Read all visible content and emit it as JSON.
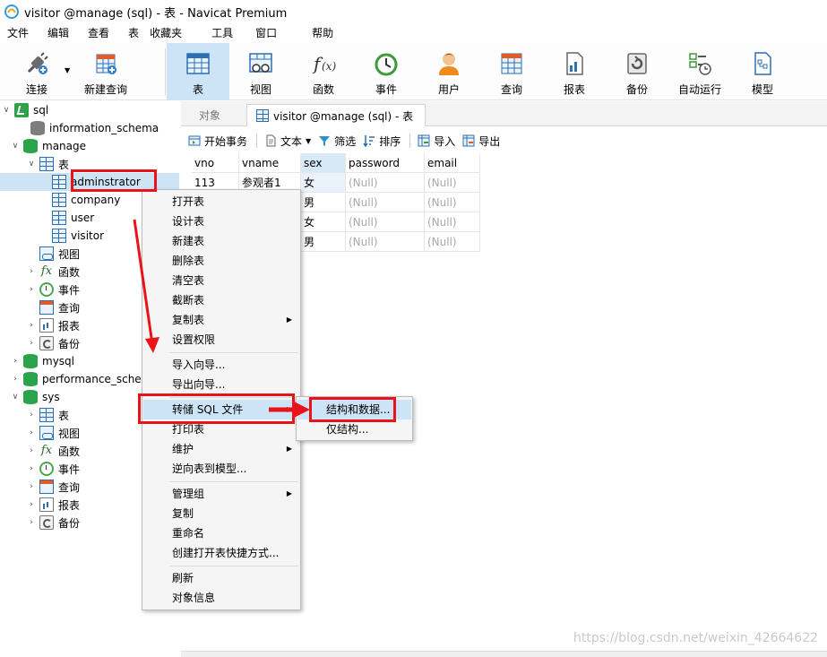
{
  "window": {
    "title": "visitor @manage (sql) - 表 - Navicat Premium"
  },
  "menu": [
    "文件",
    "编辑",
    "查看",
    "表",
    "收藏夹",
    "工具",
    "窗口",
    "帮助"
  ],
  "toolbar": {
    "connect": "连接",
    "new_query": "新建查询",
    "table": "表",
    "view": "视图",
    "function": "函数",
    "event": "事件",
    "user": "用户",
    "query": "查询",
    "report": "报表",
    "backup": "备份",
    "autorun": "自动运行",
    "model": "模型"
  },
  "tree": {
    "sql": "sql",
    "information_schema": "information_schema",
    "manage": "manage",
    "tables": "表",
    "adminstrator": "adminstrator",
    "company": "company",
    "user": "user",
    "visitor": "visitor",
    "views": "视图",
    "functions": "函数",
    "events": "事件",
    "queries": "查询",
    "reports": "报表",
    "backups": "备份",
    "mysql": "mysql",
    "performance_schema": "performance_sche",
    "sys": "sys",
    "sys_tables": "表",
    "sys_views": "视图",
    "sys_functions": "函数",
    "sys_events": "事件",
    "sys_queries": "查询",
    "sys_reports": "报表",
    "sys_backups": "备份"
  },
  "tabs": {
    "objects": "对象",
    "current": "visitor @manage (sql) - 表"
  },
  "table_toolbar": {
    "begin_tx": "开始事务",
    "text": "文本",
    "filter": "筛选",
    "sort": "排序",
    "import": "导入",
    "export": "导出"
  },
  "grid": {
    "columns": [
      "vno",
      "vname",
      "sex",
      "password",
      "email"
    ],
    "rows": [
      [
        "113",
        "参观者1",
        "女",
        "(Null)",
        "(Null)"
      ],
      [
        "",
        "",
        "男",
        "(Null)",
        "(Null)"
      ],
      [
        "",
        "",
        "女",
        "(Null)",
        "(Null)"
      ],
      [
        "",
        "",
        "男",
        "(Null)",
        "(Null)"
      ]
    ]
  },
  "context_menu": {
    "open_table": "打开表",
    "design_table": "设计表",
    "new_table": "新建表",
    "delete_table": "删除表",
    "empty_table": "清空表",
    "truncate_table": "截断表",
    "copy_table": "复制表",
    "set_permissions": "设置权限",
    "import_wizard": "导入向导...",
    "export_wizard": "导出向导...",
    "dump_sql": "转储 SQL 文件",
    "print_table": "打印表",
    "maintain": "维护",
    "reverse_to_model": "逆向表到模型...",
    "manage_group": "管理组",
    "copy": "复制",
    "rename": "重命名",
    "create_shortcut": "创建打开表快捷方式...",
    "refresh": "刷新",
    "object_info": "对象信息"
  },
  "submenu": {
    "structure_and_data": "结构和数据...",
    "structure_only": "仅结构..."
  },
  "watermark": "https://blog.csdn.net/weixin_42664622",
  "colors": {
    "highlight": "#cde4f7",
    "annotation": "#e8141a",
    "db_green": "#2aa34a"
  }
}
